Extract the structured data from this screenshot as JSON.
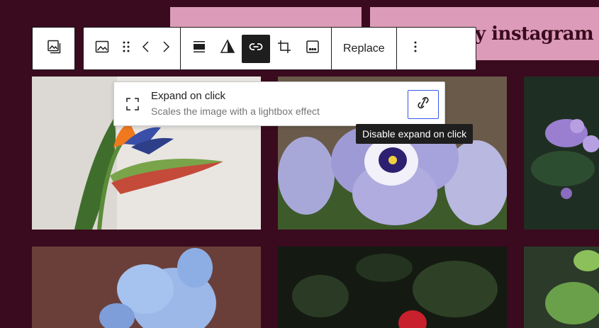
{
  "header": {
    "banner_text": "y instagram"
  },
  "toolbar": {
    "parent_icon": "gallery-icon",
    "image_icon": "image-icon",
    "drag_icon": "drag-handle-icon",
    "move_left_icon": "chevron-left-icon",
    "move_right_icon": "chevron-right-icon",
    "align_icon": "align-icon",
    "duotone_icon": "duotone-filter-icon",
    "link_icon": "link-icon",
    "crop_icon": "crop-icon",
    "text_overlay_icon": "text-overlay-icon",
    "replace_label": "Replace",
    "more_icon": "more-vertical-icon"
  },
  "popover": {
    "icon": "fullscreen-icon",
    "title": "Expand on click",
    "description": "Scales the image with a lightbox effect",
    "action_icon": "link-off-icon"
  },
  "tooltip": {
    "text": "Disable expand on click"
  },
  "colors": {
    "background": "#3a0a1e",
    "banner": "#dc9bb8",
    "toolbar_border": "#1e1e1e",
    "accent": "#3858e9"
  }
}
